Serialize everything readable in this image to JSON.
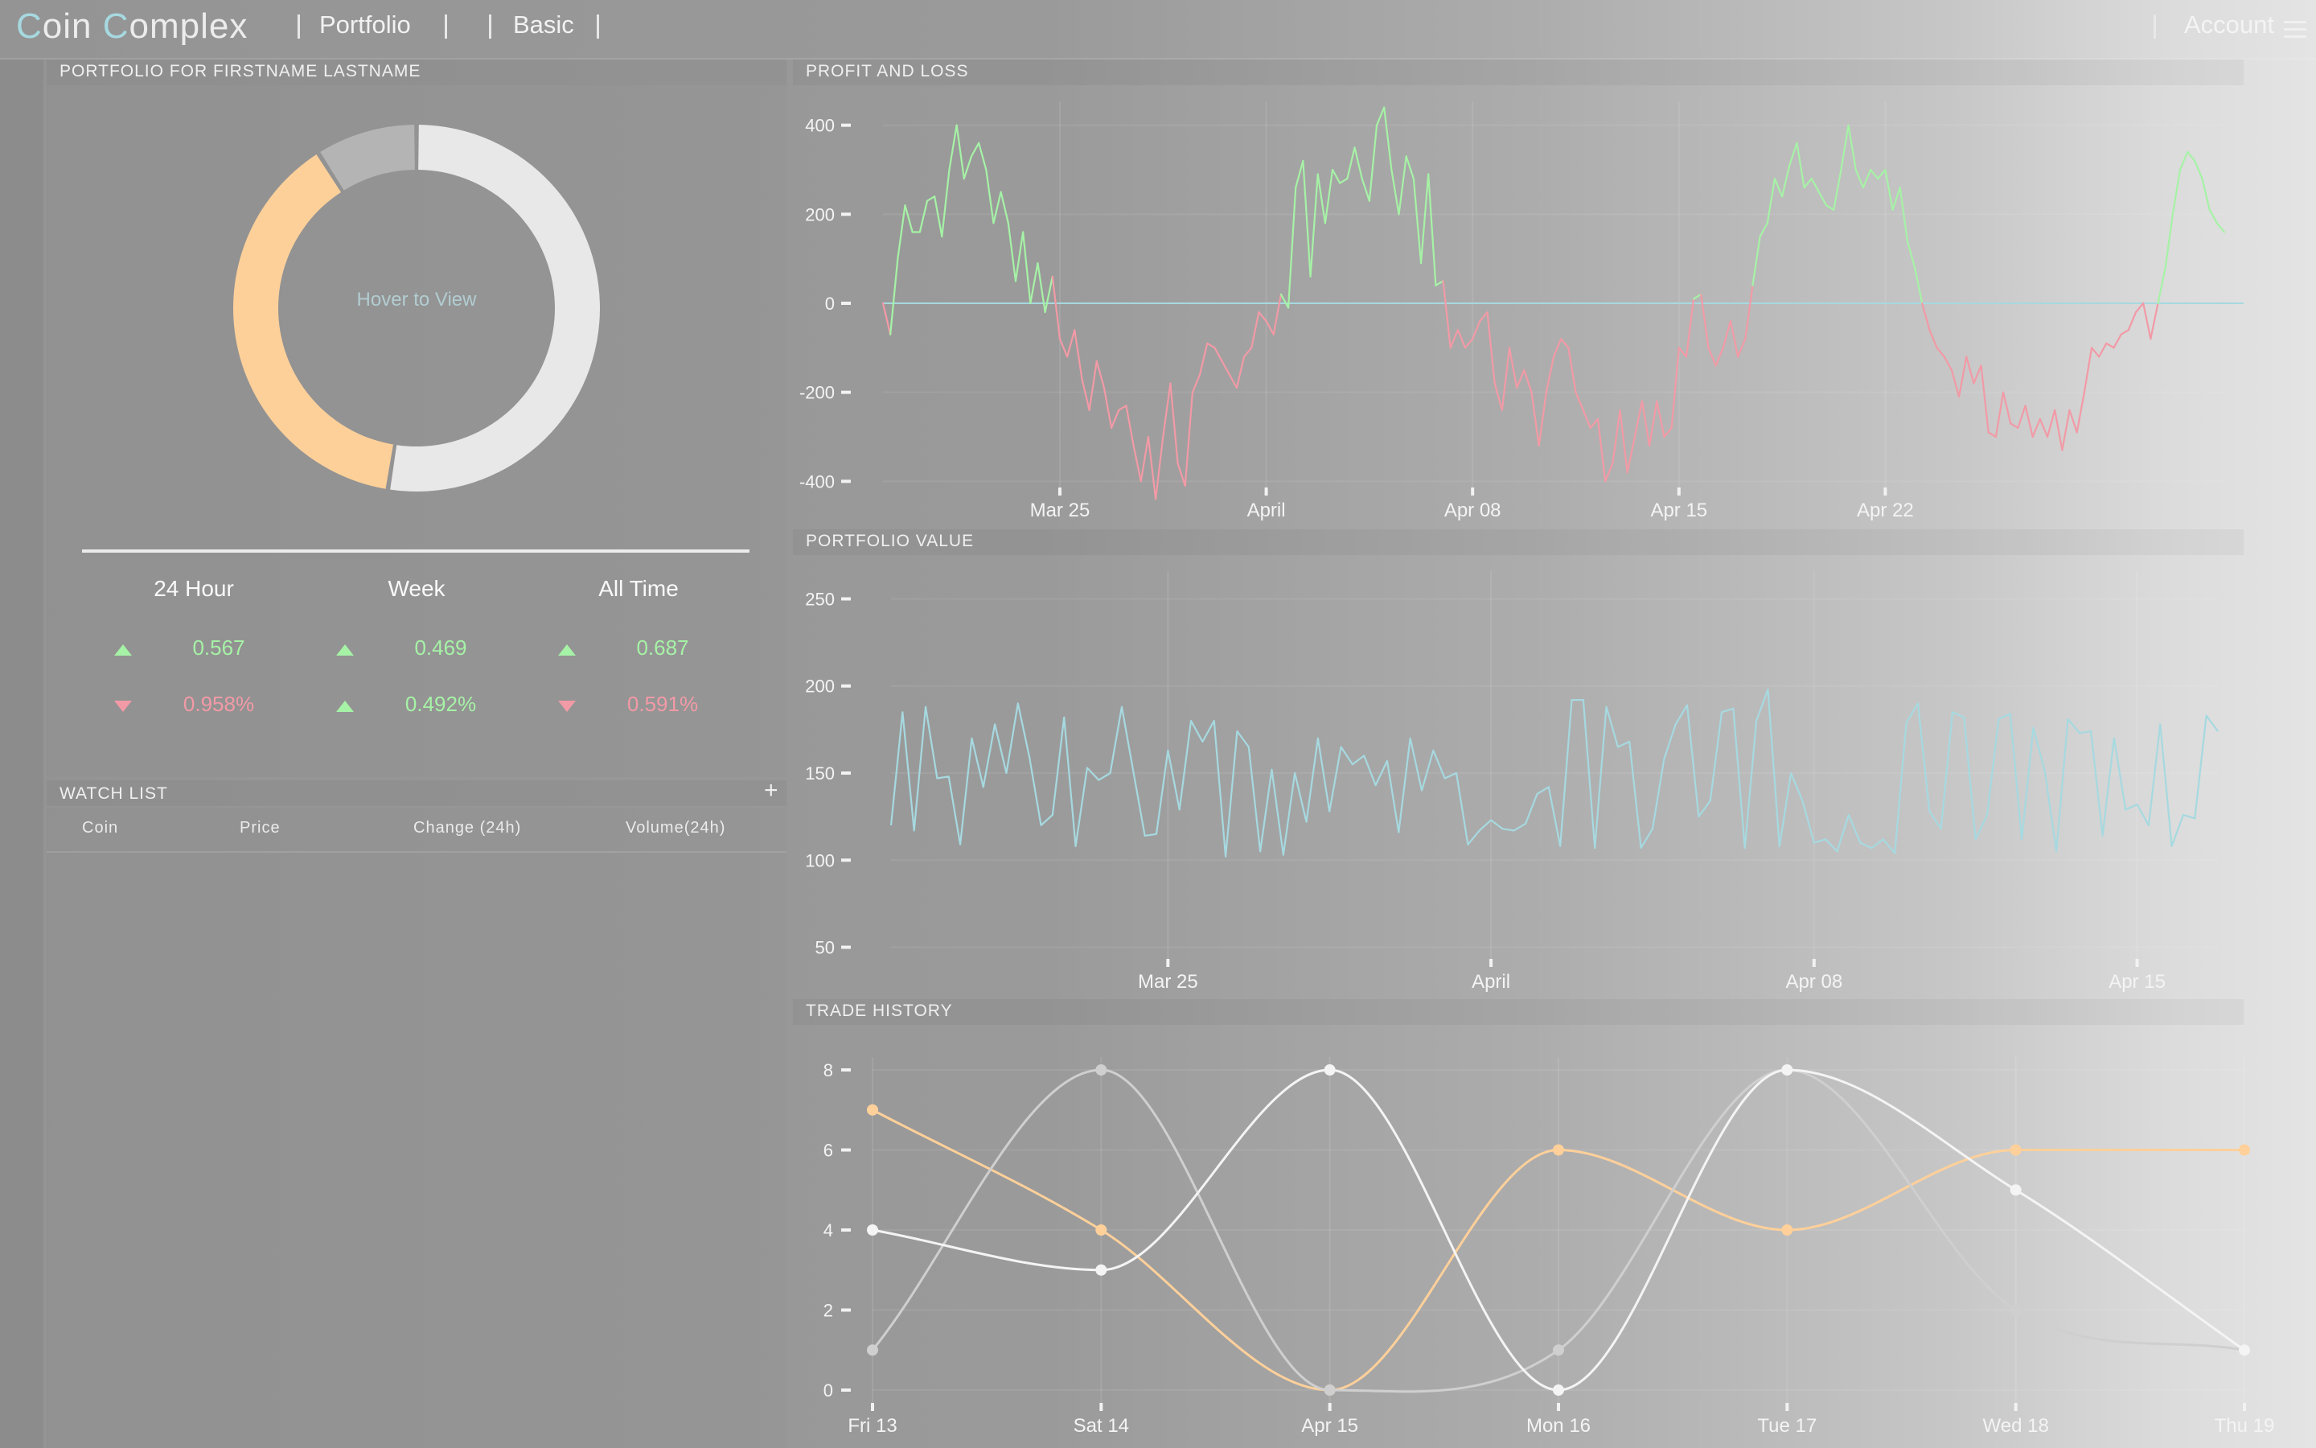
{
  "app": {
    "title_first": "C",
    "title_mid1": "oin ",
    "title_c2": "C",
    "title_rest": "omplex"
  },
  "nav": {
    "portfolio": "Portfolio",
    "basic": "Basic",
    "account": "Account"
  },
  "portfolio": {
    "title": "PORTFOLIO FOR FIRSTNAME LASTNAME",
    "donut_hint": "Hover to View",
    "stats": {
      "headers": [
        "24 Hour",
        "Week",
        "All Time"
      ],
      "row1": [
        {
          "value": "0.567",
          "dir": "up"
        },
        {
          "value": "0.469",
          "dir": "up"
        },
        {
          "value": "0.687",
          "dir": "up"
        }
      ],
      "row2": [
        {
          "value": "0.958%",
          "dir": "down"
        },
        {
          "value": "0.492%",
          "dir": "up"
        },
        {
          "value": "0.591%",
          "dir": "down"
        }
      ]
    }
  },
  "watchlist": {
    "title": "WATCH LIST",
    "add_label": "+",
    "columns": [
      "Coin",
      "Price",
      "Change (24h)",
      "Volume(24h)"
    ]
  },
  "colors": {
    "profit": "#a6f2a6",
    "loss": "#f29aa6",
    "value_line": "#a6d9e0",
    "series_orange": "#ffd09a",
    "series_white": "#f4f4f4",
    "series_grey": "#cfcfcf",
    "donut_light": "#e8e8e8",
    "donut_orange": "#fdd09a",
    "donut_grey": "#b4b4b4"
  },
  "chart_data": [
    {
      "id": "donut",
      "type": "pie",
      "slices": [
        {
          "name": "",
          "value": 52.5,
          "color": "#e8e8e8"
        },
        {
          "name": "",
          "value": 38.5,
          "color": "#fdd09a"
        },
        {
          "name": "",
          "value": 9.0,
          "color": "#b4b4b4"
        }
      ]
    },
    {
      "id": "pnl",
      "type": "line",
      "title": "PROFIT AND LOSS",
      "x_start": "2018-03-19",
      "x_step_days": 0.25,
      "xticks": [
        {
          "label": "Mar 25",
          "date": "2018-03-25"
        },
        {
          "label": "April",
          "date": "2018-04-01"
        },
        {
          "label": "Apr 08",
          "date": "2018-04-08"
        },
        {
          "label": "Apr 15",
          "date": "2018-04-15"
        },
        {
          "label": "Apr 22",
          "date": "2018-04-22"
        }
      ],
      "yticks": [
        400,
        200,
        0,
        -200,
        -400
      ],
      "ylim": [
        -450,
        450
      ],
      "values": [
        0,
        -70,
        100,
        220,
        160,
        160,
        230,
        240,
        150,
        300,
        400,
        280,
        330,
        360,
        300,
        180,
        250,
        180,
        50,
        160,
        0,
        90,
        -20,
        60,
        -80,
        -120,
        -60,
        -170,
        -240,
        -130,
        -190,
        -280,
        -240,
        -230,
        -320,
        -400,
        -300,
        -440,
        -300,
        -180,
        -360,
        -410,
        -200,
        -160,
        -90,
        -100,
        -130,
        -160,
        -190,
        -120,
        -100,
        -20,
        -40,
        -70,
        20,
        -10,
        260,
        320,
        60,
        290,
        180,
        300,
        270,
        280,
        350,
        280,
        230,
        400,
        440,
        300,
        200,
        330,
        280,
        90,
        290,
        40,
        50,
        -100,
        -60,
        -100,
        -80,
        -40,
        -20,
        -180,
        -240,
        -100,
        -190,
        -150,
        -200,
        -320,
        -200,
        -120,
        -80,
        -100,
        -200,
        -240,
        -280,
        -260,
        -400,
        -360,
        -240,
        -380,
        -300,
        -220,
        -320,
        -220,
        -300,
        -280,
        -100,
        -120,
        10,
        20,
        -100,
        -140,
        -100,
        -40,
        -120,
        -80,
        40,
        150,
        180,
        280,
        240,
        310,
        360,
        260,
        280,
        250,
        220,
        210,
        300,
        400,
        300,
        260,
        300,
        280,
        300,
        210,
        260,
        140,
        80,
        0,
        -60,
        -100,
        -120,
        -150,
        -210,
        -120,
        -180,
        -140,
        -290,
        -300,
        -200,
        -270,
        -280,
        -230,
        -300,
        -260,
        -300,
        -240,
        -330,
        -240,
        -290,
        -200,
        -100,
        -120,
        -90,
        -100,
        -70,
        -60,
        -20,
        0,
        -80,
        0,
        80,
        200,
        300,
        340,
        320,
        280,
        210,
        180,
        160
      ]
    },
    {
      "id": "value",
      "type": "line",
      "title": "PORTFOLIO VALUE",
      "x_start": "2018-03-19",
      "x_step_days": 0.25,
      "xticks": [
        {
          "label": "Mar 25",
          "date": "2018-03-25"
        },
        {
          "label": "April",
          "date": "2018-04-01"
        },
        {
          "label": "Apr 08",
          "date": "2018-04-08"
        },
        {
          "label": "Apr 15",
          "date": "2018-04-15"
        }
      ],
      "yticks": [
        250,
        200,
        150,
        100,
        50
      ],
      "ylim": [
        35,
        265
      ],
      "values": [
        120,
        185,
        117,
        188,
        147,
        148,
        109,
        170,
        142,
        178,
        150,
        190,
        159,
        120,
        126,
        182,
        108,
        153,
        146,
        150,
        188,
        151,
        114,
        115,
        163,
        129,
        180,
        168,
        180,
        102,
        174,
        165,
        105,
        152,
        103,
        150,
        122,
        170,
        128,
        165,
        155,
        160,
        143,
        157,
        116,
        170,
        140,
        163,
        147,
        150,
        109,
        117,
        123,
        118,
        117,
        121,
        138,
        142,
        108,
        192,
        192,
        107,
        188,
        165,
        168,
        107,
        118,
        158,
        178,
        189,
        125,
        134,
        185,
        187,
        107,
        180,
        198,
        108,
        150,
        134,
        110,
        112,
        105,
        126,
        110,
        107,
        112,
        104,
        179,
        190,
        128,
        118,
        185,
        182,
        112,
        126,
        181,
        184,
        112,
        176,
        151,
        105,
        181,
        173,
        174,
        114,
        170,
        129,
        132,
        120,
        178,
        108,
        126,
        124,
        183,
        174
      ]
    },
    {
      "id": "trades",
      "type": "line",
      "title": "TRADE HISTORY",
      "categories": [
        "Fri 13",
        "Sat 14",
        "Apr 15",
        "Mon 16",
        "Tue 17",
        "Wed 18",
        "Thu 19"
      ],
      "yticks": [
        8,
        6,
        4,
        2,
        0
      ],
      "ylim": [
        0,
        8
      ],
      "series": [
        {
          "color": "#ffd09a",
          "values": [
            7,
            4,
            0,
            6,
            4,
            6,
            6
          ]
        },
        {
          "color": "#cfcfcf",
          "values": [
            1,
            8,
            0,
            1,
            8,
            2,
            1
          ]
        },
        {
          "color": "#f4f4f4",
          "values": [
            4,
            3,
            8,
            0,
            8,
            5,
            1
          ]
        }
      ]
    }
  ]
}
